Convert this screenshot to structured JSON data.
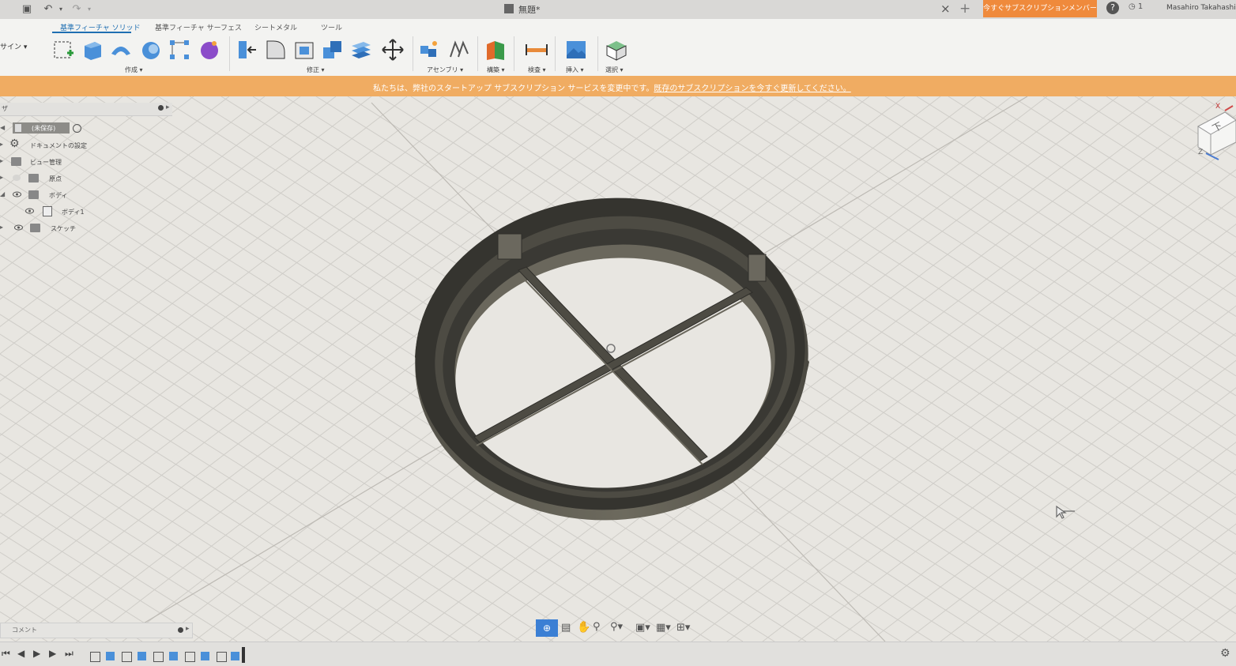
{
  "titlebar": {
    "document_title": "無題*",
    "close_label": "×",
    "new_tab_label": "+",
    "subscription_button": "今すぐサブスクリプションメンバーに",
    "notification_count": "1",
    "user_name": "Masahiro Takahashi"
  },
  "toolbar": {
    "workspace_label": "サイン ▾",
    "tabs": [
      "基準フィーチャ ソリッド",
      "基準フィーチャ サーフェス",
      "シートメタル",
      "ツール"
    ],
    "groups": [
      "作成 ▾",
      "修正 ▾",
      "アセンブリ ▾",
      "構築 ▾",
      "検査 ▾",
      "挿入 ▾",
      "選択 ▾"
    ]
  },
  "banner": {
    "text": "私たちは、弊社のスタートアップ サブスクリプション サービスを変更中です。",
    "link": "既存のサブスクリプションを今すぐ更新してください。"
  },
  "browser": {
    "title": "ザ",
    "items": [
      {
        "label": "(未保存)"
      },
      {
        "label": "ドキュメントの設定"
      },
      {
        "label": "ビュー管理"
      },
      {
        "label": "原点"
      },
      {
        "label": "ボディ"
      },
      {
        "label": "ボディ1"
      },
      {
        "label": "スケッチ"
      }
    ]
  },
  "comments": {
    "title": "コメント"
  },
  "viewcube": {
    "x_label": "X",
    "face_label": "下",
    "z_label": "Z"
  },
  "colors": {
    "accent": "#1f6fb2",
    "banner": "#f0ac62",
    "subscribe": "#ef8a3c",
    "body": "#4e4c44"
  }
}
